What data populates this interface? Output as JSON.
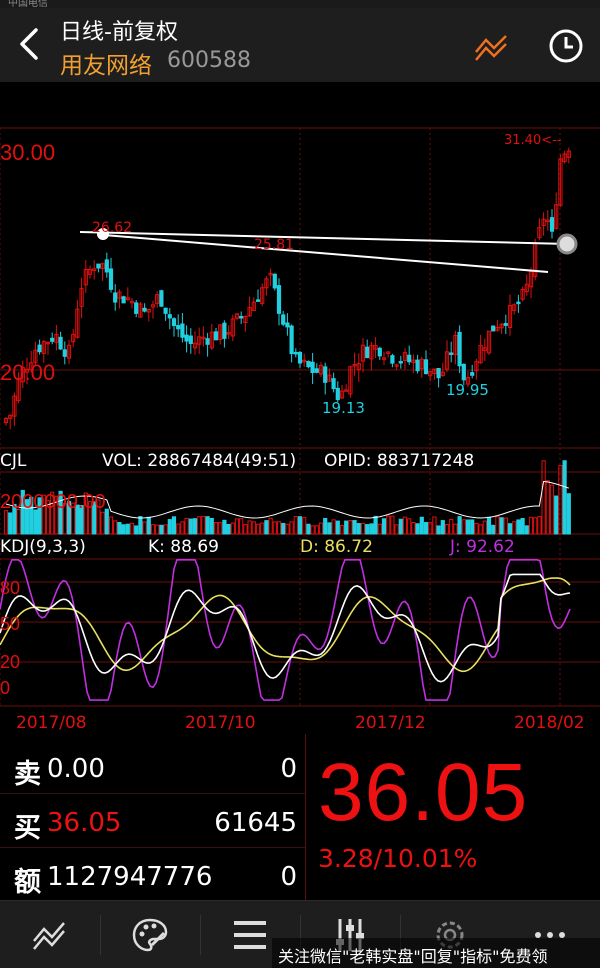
{
  "status_bar": {
    "carrier": "中国电信"
  },
  "header": {
    "title": "日线-前复权",
    "stock_name": "用友网络",
    "stock_code": "600588"
  },
  "chart": {
    "price_axis": {
      "top_label": "30.00",
      "bottom_label": "20.00"
    },
    "price_annotations": {
      "high": "26.62",
      "mid_high": "25.81",
      "low1": "19.13",
      "low2": "19.95",
      "latest_high": "31.40<--"
    },
    "volume_header": {
      "label": "CJL",
      "vol": "VOL: 28867484(49:51)",
      "opid": "OPID: 883717248"
    },
    "volume_axis_label": "2000000.00",
    "kdj_header": {
      "label": "KDJ(9,3,3)",
      "k": "K: 88.69",
      "d": "D: 86.72",
      "j": "J: 92.62"
    },
    "kdj_axis": [
      "80",
      "50",
      "20",
      "0"
    ],
    "dates": [
      "2017/08",
      "2017/10",
      "2017/12",
      "2018/02"
    ],
    "colors": {
      "up": "#e01010",
      "down": "#20d0e0",
      "k_line": "#ffffff",
      "d_line": "#e8e060",
      "j_line": "#c030e0",
      "grid": "#6a0e0e"
    }
  },
  "chart_data": {
    "type": "candlestick",
    "title": "日线-前复权",
    "price_range": [
      17.0,
      32.5
    ],
    "annotated_prices": [
      26.62,
      25.81,
      19.13,
      19.95,
      31.4
    ],
    "kdj": {
      "k": 88.69,
      "d": 86.72,
      "j": 92.62
    },
    "volume": 28867484,
    "x_labels": [
      "2017/08",
      "2017/10",
      "2017/12",
      "2018/02"
    ]
  },
  "quote": {
    "sell_label": "卖",
    "sell_price": "0.00",
    "sell_vol": "0",
    "buy_label": "买",
    "buy_price": "36.05",
    "buy_vol": "61645",
    "amount_label": "额",
    "amount_value": "1127947776",
    "amount_vol": "0",
    "last_price": "36.05",
    "change": "3.28/10.01%"
  },
  "watermark": {
    "text": "关注微信\"老韩实盘\"回复\"指标\"免费领"
  }
}
